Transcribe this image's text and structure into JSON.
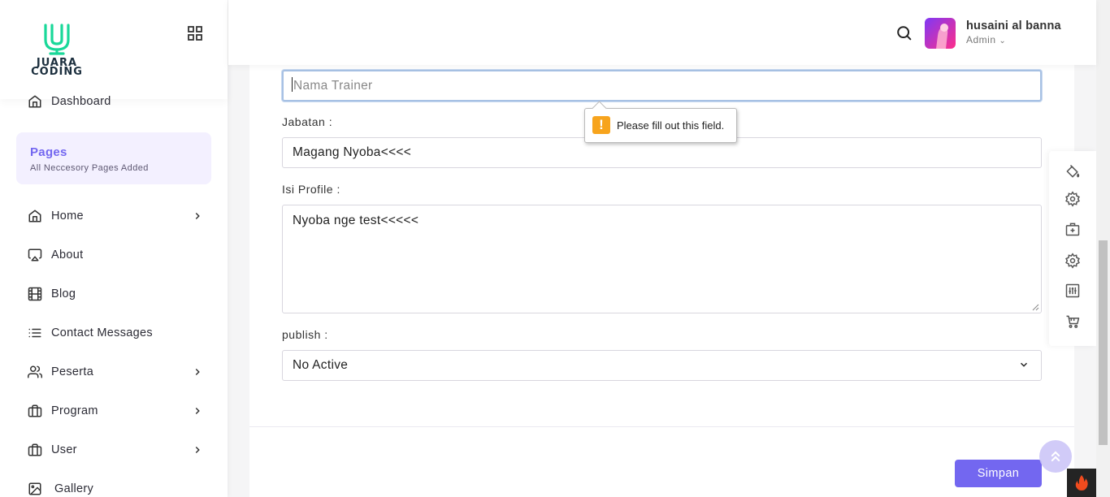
{
  "brand": {
    "logo_line1": "JUARA",
    "logo_line2": "CODING",
    "accent": "#7367f0",
    "logo_color": "#19d899"
  },
  "sidebar": {
    "dashboard": "Dashboard",
    "pages_title": "Pages",
    "pages_subtitle": "All Neccesory Pages Added",
    "items": [
      {
        "label": "Home",
        "icon": "home-icon",
        "has_children": true
      },
      {
        "label": "About",
        "icon": "airplay-icon",
        "has_children": false
      },
      {
        "label": "Blog",
        "icon": "film-icon",
        "has_children": false
      },
      {
        "label": "Contact Messages",
        "icon": "list-icon",
        "has_children": false
      },
      {
        "label": "Peserta",
        "icon": "users-icon",
        "has_children": true
      },
      {
        "label": "Program",
        "icon": "briefcase-icon",
        "has_children": true
      },
      {
        "label": "User",
        "icon": "briefcase-icon",
        "has_children": true
      },
      {
        "label": "Gallery",
        "icon": "image-icon",
        "has_children": false
      }
    ]
  },
  "header": {
    "user_name": "husaini al banna",
    "user_role": "Admin"
  },
  "form": {
    "nama_trainer": {
      "placeholder": "Nama Trainer",
      "value": ""
    },
    "jabatan": {
      "label": "Jabatan :",
      "value": "Magang Nyoba<<<<"
    },
    "isi_profile": {
      "label": "Isi Profile :",
      "value": "Nyoba nge test<<<<<"
    },
    "publish": {
      "label": "publish :",
      "selected": "No Active"
    },
    "submit_label": "Simpan"
  },
  "validation_tooltip": {
    "message": "Please fill out this field.",
    "icon": "warning-icon",
    "color": "#f7a41d"
  },
  "right_toolbar": [
    "paint-bucket-icon",
    "settings-icon",
    "briefcase-plus-icon",
    "settings-icon",
    "sliders-icon",
    "cart-icon"
  ]
}
